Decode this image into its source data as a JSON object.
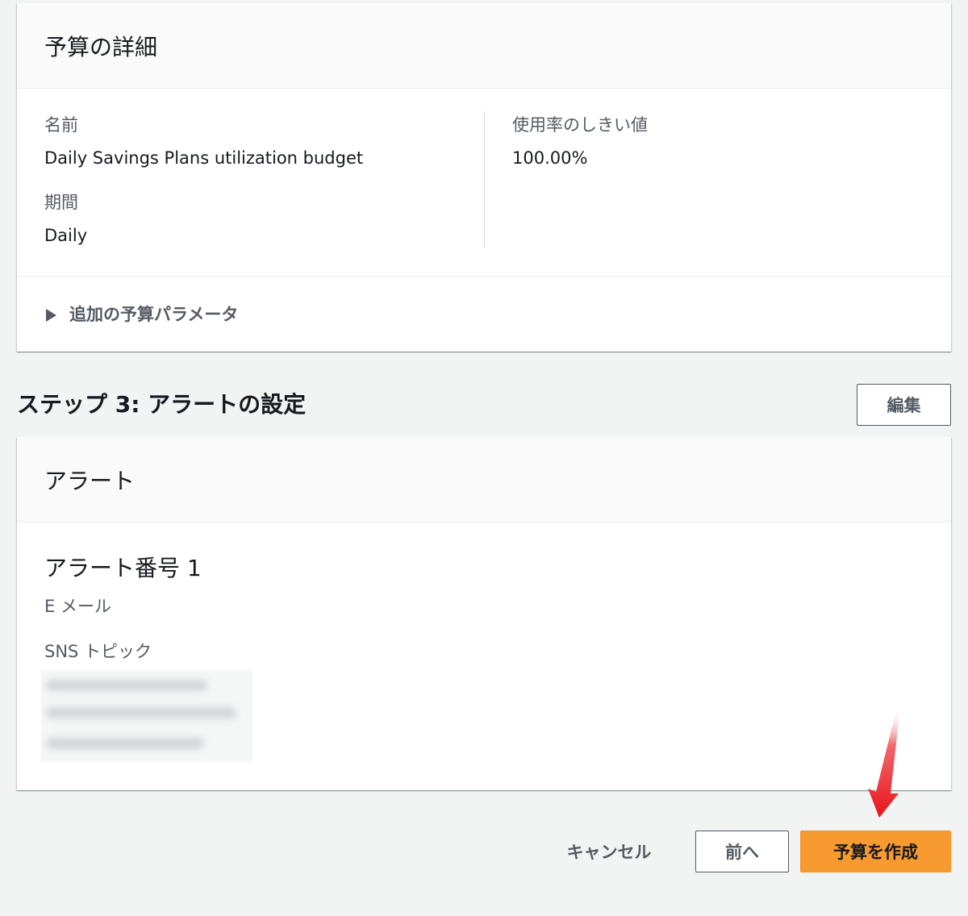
{
  "budget_details": {
    "title": "予算の詳細",
    "name_label": "名前",
    "name_value": "Daily Savings Plans utilization budget",
    "period_label": "期間",
    "period_value": "Daily",
    "threshold_label": "使用率のしきい値",
    "threshold_value": "100.00%",
    "additional_params_label": "追加の予算パラメータ"
  },
  "step3": {
    "heading": "ステップ 3: アラートの設定",
    "edit_label": "編集"
  },
  "alerts": {
    "title": "アラート",
    "alert_title": "アラート番号 1",
    "email_label": "E メール",
    "sns_label": "SNS トピック"
  },
  "footer": {
    "cancel_label": "キャンセル",
    "prev_label": "前へ",
    "create_label": "予算を作成"
  },
  "colors": {
    "primary_button": "#f79a30",
    "annotation_arrow": "#e8131b"
  }
}
